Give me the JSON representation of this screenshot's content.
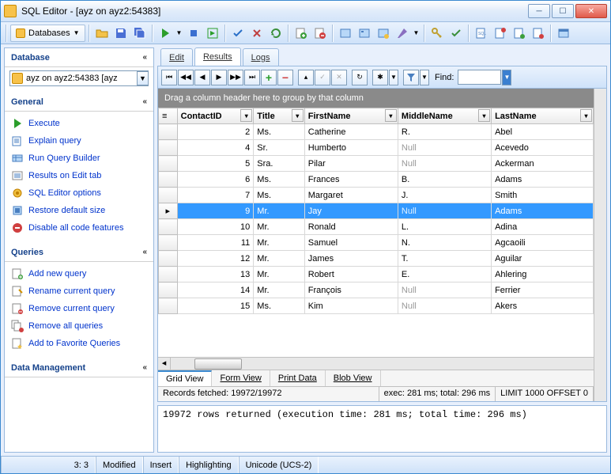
{
  "window": {
    "title": "SQL Editor - [ayz on ayz2:54383]"
  },
  "toolbar": {
    "databases_label": "Databases"
  },
  "sidebar": {
    "database": {
      "header": "Database",
      "selected": "ayz on ayz2:54383 [ayz"
    },
    "general": {
      "header": "General",
      "items": [
        {
          "label": "Execute"
        },
        {
          "label": "Explain query"
        },
        {
          "label": "Run Query Builder"
        },
        {
          "label": "Results on Edit tab"
        },
        {
          "label": "SQL Editor options"
        },
        {
          "label": "Restore default size"
        },
        {
          "label": "Disable all code features"
        }
      ]
    },
    "queries": {
      "header": "Queries",
      "items": [
        {
          "label": "Add new query"
        },
        {
          "label": "Rename current query"
        },
        {
          "label": "Remove current query"
        },
        {
          "label": "Remove all queries"
        },
        {
          "label": "Add to Favorite Queries"
        }
      ]
    },
    "data_mgmt": {
      "header": "Data Management"
    }
  },
  "tabs": {
    "edit": "Edit",
    "results": "Results",
    "logs": "Logs"
  },
  "find": {
    "label": "Find:"
  },
  "groupbar": "Drag a column header here to group by that column",
  "grid": {
    "columns": [
      "ContactID",
      "Title",
      "FirstName",
      "MiddleName",
      "LastName"
    ],
    "rows": [
      {
        "id": "2",
        "title": "Ms.",
        "first": "Catherine",
        "middle": "R.",
        "last": "Abel"
      },
      {
        "id": "4",
        "title": "Sr.",
        "first": "Humberto",
        "middle": null,
        "last": "Acevedo"
      },
      {
        "id": "5",
        "title": "Sra.",
        "first": "Pilar",
        "middle": null,
        "last": "Ackerman"
      },
      {
        "id": "6",
        "title": "Ms.",
        "first": "Frances",
        "middle": "B.",
        "last": "Adams"
      },
      {
        "id": "7",
        "title": "Ms.",
        "first": "Margaret",
        "middle": "J.",
        "last": "Smith"
      },
      {
        "id": "9",
        "title": "Mr.",
        "first": "Jay",
        "middle": null,
        "last": "Adams",
        "selected": true,
        "marker": "▸"
      },
      {
        "id": "10",
        "title": "Mr.",
        "first": "Ronald",
        "middle": "L.",
        "last": "Adina"
      },
      {
        "id": "11",
        "title": "Mr.",
        "first": "Samuel",
        "middle": "N.",
        "last": "Agcaoili"
      },
      {
        "id": "12",
        "title": "Mr.",
        "first": "James",
        "middle": "T.",
        "last": "Aguilar"
      },
      {
        "id": "13",
        "title": "Mr.",
        "first": "Robert",
        "middle": "E.",
        "last": "Ahlering"
      },
      {
        "id": "14",
        "title": "Mr.",
        "first": "François",
        "middle": null,
        "last": "Ferrier"
      },
      {
        "id": "15",
        "title": "Ms.",
        "first": "Kim",
        "middle": null,
        "last": "Akers"
      }
    ]
  },
  "viewtabs": {
    "grid": "Grid View",
    "form": "Form View",
    "print": "Print Data",
    "blob": "Blob View"
  },
  "status": {
    "fetched": "Records fetched: 19972/19972",
    "exec": "exec: 281 ms; total: 296 ms",
    "limit": "LIMIT 1000 OFFSET 0"
  },
  "console": "19972 rows returned (execution time: 281 ms; total time: 296 ms)",
  "bottombar": {
    "pos": "3:   3",
    "modified": "Modified",
    "insert": "Insert",
    "highlight": "Highlighting",
    "encoding": "Unicode (UCS-2)"
  },
  "null_label": "Null"
}
